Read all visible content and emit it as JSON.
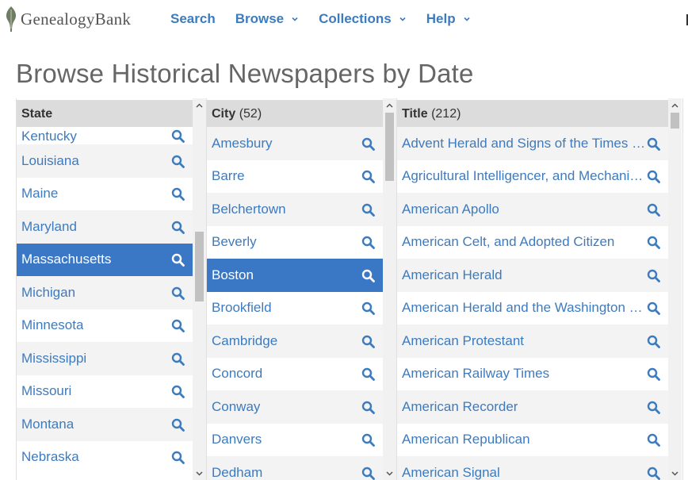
{
  "brand": {
    "logo_text": "GenealogyBank"
  },
  "nav": [
    {
      "label": "Search",
      "has_dropdown": false
    },
    {
      "label": "Browse",
      "has_dropdown": true
    },
    {
      "label": "Collections",
      "has_dropdown": true
    },
    {
      "label": "Help",
      "has_dropdown": true
    }
  ],
  "page": {
    "title": "Browse Historical Newspapers by Date"
  },
  "columns": {
    "state": {
      "header": "State",
      "count": "",
      "selected": "Massachusetts",
      "items": [
        "Kentucky",
        "Louisiana",
        "Maine",
        "Maryland",
        "Massachusetts",
        "Michigan",
        "Minnesota",
        "Mississippi",
        "Missouri",
        "Montana",
        "Nebraska"
      ]
    },
    "city": {
      "header": "City",
      "count": "(52)",
      "selected": "Boston",
      "items": [
        "Amesbury",
        "Barre",
        "Belchertown",
        "Beverly",
        "Boston",
        "Brookfield",
        "Cambridge",
        "Concord",
        "Conway",
        "Danvers",
        "Dedham"
      ]
    },
    "title": {
      "header": "Title",
      "count": "(212)",
      "items": [
        "Advent Herald and Signs of the Times R...",
        "Agricultural Intelligencer, and Mechanic ...",
        "American Apollo",
        "American Celt, and Adopted Citizen",
        "American Herald",
        "American Herald and the Washington G...",
        "American Protestant",
        "American Railway Times",
        "American Recorder",
        "American Republican",
        "American Signal"
      ]
    }
  },
  "colors": {
    "link": "#3d7bbf",
    "selected_bg": "#3a78c6",
    "header_bg": "#dcdcdc",
    "alt_row": "#f3f3f3"
  },
  "icons": {
    "row_action": "magnifier-icon",
    "dropdown": "chevron-down-icon"
  }
}
